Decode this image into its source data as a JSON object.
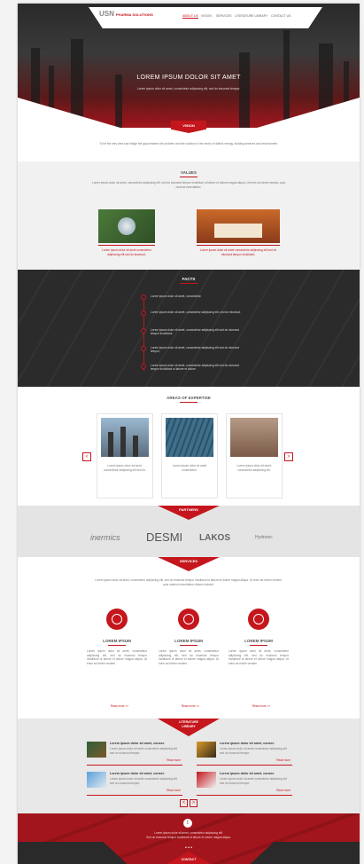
{
  "header": {
    "logo_text": "USN",
    "logo_sub": "PHARMA SOLUTIONS",
    "nav": [
      "ABOUT US",
      "VISION",
      "SERVICES",
      "LITERATURE LIBRARY",
      "CONTACT US"
    ]
  },
  "hero": {
    "title": "LOREM IPSUM DOLOR SIT AMET",
    "subtitle": "Lorem ipsum dolor sit amet, consectetur adipiscing elit, sed do eiusmod tempor."
  },
  "vision": {
    "label": "VISION",
    "text": "To be the very best and bridge the gap between the problem and the solution in the sector of district energy, building services and heat transfer."
  },
  "values": {
    "title": "VALUES",
    "text": "Lorem ipsum dolor sit amet, consectetur adipiscing elit, sed do eiusmod tempor incididunt ut labore et dolore magna aliqua. Ut enim ad minim veniam, quis nostrud exercitation.",
    "items": [
      {
        "caption": "Lorem ipsum dolor sit amet consectetur adipiscing elit sed do eiusmod."
      },
      {
        "caption": "Lorem ipsum dolor sit amet consectetur adipiscing elit sed do eiusmod tempor incididunt."
      }
    ]
  },
  "facts": {
    "title": "FACTS",
    "items": [
      "Lorem ipsum dolor sit amet, consectetur.",
      "Lorem ipsum dolor sit amet, consectetur adipiscing elit, sed do eiusmod.",
      "Lorem ipsum dolor sit amet, consectetur adipiscing elit sed do eiusmod tempor incididunt.",
      "Lorem ipsum dolor sit amet, consectetur adipiscing elit sed do eiusmod tempor.",
      "Lorem ipsum dolor sit amet, consectetur adipiscing elit sed do eiusmod tempor incididunt ut labore et dolore."
    ]
  },
  "expertise": {
    "title": "AREAS OF EXPERTISE",
    "cards": [
      {
        "caption": "Lorem ipsum dolor sit amet, consectetur adipiscing elit sed do."
      },
      {
        "caption": "Lorem ipsum dolor sit amet consectetur."
      },
      {
        "caption": "Lorem ipsum dolor sit amet, consectetur adipiscing elit."
      }
    ],
    "prev": "<",
    "next": ">"
  },
  "partners": {
    "label": "PARTNERS",
    "logos": [
      "inermics",
      "DESMI",
      "LAKOS",
      "Hydronic"
    ]
  },
  "services": {
    "label": "SERVICES",
    "text": "Lorem ipsum dolor sit amet, consectetur adipiscing elit, sed do eiusmod tempor incididunt ut labore et dolore magna aliqua. Ut enim ad minim veniam, quis nostrud exercitation ullamco laboris.",
    "items": [
      {
        "title": "LOREM IPSUM",
        "text": "Lorem ipsum dolor sit amet, consectetur adipiscing elit, sed do eiusmod tempor incididunt ut labore et dolore magna aliqua. Ut enim ad minim veniam.",
        "link": "Read more >>"
      },
      {
        "title": "LOREM IPSUM",
        "text": "Lorem ipsum dolor sit amet, consectetur adipiscing elit, sed do eiusmod tempor incididunt ut labore et dolore magna aliqua. Ut enim ad minim veniam.",
        "link": "Read more >>"
      },
      {
        "title": "LOREM IPSUM",
        "text": "Lorem ipsum dolor sit amet, consectetur adipiscing elit, sed do eiusmod tempor incididunt ut labore et dolore magna aliqua. Ut enim ad minim veniam.",
        "link": "Read more >>"
      }
    ]
  },
  "library": {
    "label": "LITERATURE LIBRARY",
    "items": [
      {
        "title": "Lorem ipsum dolor sit amet, consec",
        "text": "Lorem ipsum dolor sit amet consectetur adipiscing elit sed do eiusmod tempor.",
        "link": "Read more"
      },
      {
        "title": "Lorem ipsum dolor sit amet, consec",
        "text": "Lorem ipsum dolor sit amet consectetur adipiscing elit sed do eiusmod tempor.",
        "link": "Read more"
      },
      {
        "title": "Lorem ipsum dolor sit amet, consec",
        "text": "Lorem ipsum dolor sit amet consectetur adipiscing elit sed do eiusmod tempor.",
        "link": "Read more"
      },
      {
        "title": "Lorem ipsum dolor sit amet, consec",
        "text": "Lorem ipsum dolor sit amet consectetur adipiscing elit sed do eiusmod tempor.",
        "link": "Read more"
      }
    ],
    "prev": "<",
    "next": ">"
  },
  "footer": {
    "text": "Lorem ipsum dolor sit amet, consectetur adipiscing elit.",
    "text2": "Sed do eiusmod tempor incididunt ut labore et dolore magna aliqua.",
    "dots": "• • •",
    "contact_label": "CONTACT"
  },
  "colors": {
    "accent": "#c4161c",
    "dark": "#2b2b2b"
  }
}
